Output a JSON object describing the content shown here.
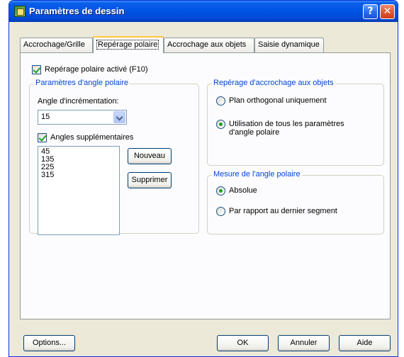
{
  "window": {
    "title": "Paramètres de dessin"
  },
  "tabs": [
    "Accrochage/Grille",
    "Repérage polaire",
    "Accrochage aux objets",
    "Saisie dynamique"
  ],
  "polar": {
    "enable_label": "Repérage polaire activé (F10)",
    "enable_checked": true,
    "angle_group_title": "Paramètres d'angle polaire",
    "increment_label": "Angle d'incrémentation:",
    "increment_value": "15",
    "additional_label": "Angles supplémentaires",
    "additional_checked": true,
    "angles": [
      "45",
      "135",
      "225",
      "315"
    ],
    "new_button": "Nouveau",
    "delete_button": "Supprimer"
  },
  "snap_tracking": {
    "title": "Repérage d'accrochage aux objets",
    "options": [
      "Plan orthogonal uniquement",
      "Utilisation de tous les paramètres d'angle polaire"
    ],
    "selected_index": 1
  },
  "measure": {
    "title": "Mesure de l'angle polaire",
    "options": [
      "Absolue",
      "Par rapport au dernier segment"
    ],
    "selected_index": 0
  },
  "footer": {
    "options": "Options...",
    "ok": "OK",
    "cancel": "Annuler",
    "help": "Aide"
  },
  "colors": {
    "title_bar": "#0054e3",
    "dialog_bg": "#ece9d8",
    "group_title": "#0046d5",
    "active_tab_accent": "#ffc83c"
  }
}
